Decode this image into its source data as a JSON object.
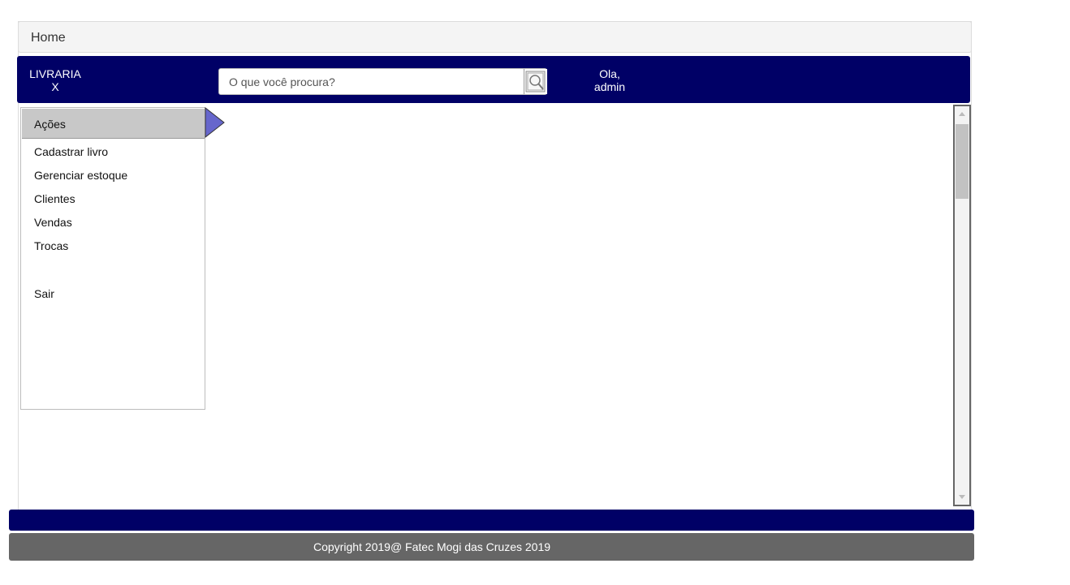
{
  "breadcrumb": {
    "label": "Home"
  },
  "header": {
    "brand_line1": "LIVRARIA",
    "brand_line2": "X",
    "greeting_line1": "Ola,",
    "greeting_line2": "admin"
  },
  "search": {
    "placeholder": "O que você procura?",
    "button_icon": "magnifier-icon"
  },
  "sidebar": {
    "title": "Ações",
    "items": [
      {
        "label": "Cadastrar livro"
      },
      {
        "label": "Gerenciar estoque"
      },
      {
        "label": "Clientes"
      },
      {
        "label": "Vendas"
      },
      {
        "label": "Trocas"
      },
      {
        "label": "Sair"
      }
    ]
  },
  "footer": {
    "copyright": "Copyright 2019@ Fatec Mogi das Cruzes 2019"
  },
  "colors": {
    "header": "#000066",
    "footer": "#666666",
    "arrow": "#6666cc"
  }
}
